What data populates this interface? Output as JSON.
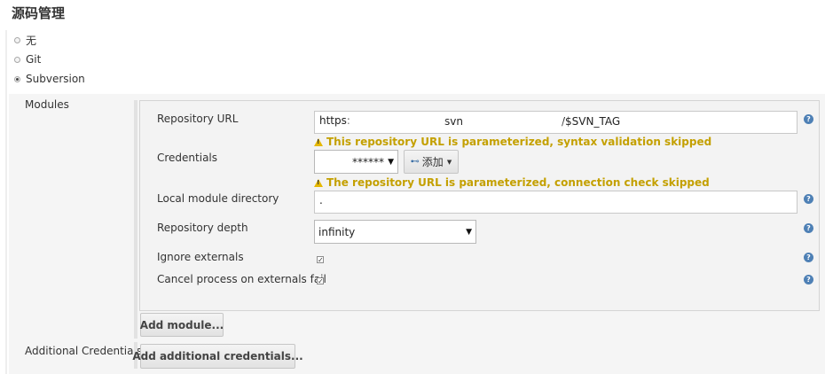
{
  "section": {
    "title": "源码管理"
  },
  "scm_options": [
    {
      "label": "无",
      "selected": false
    },
    {
      "label": "Git",
      "selected": false
    },
    {
      "label": "Subversion",
      "selected": true
    }
  ],
  "modules": {
    "label": "Modules",
    "repository_url": {
      "label": "Repository URL",
      "value_prefix": "https:",
      "value_mid": "svn",
      "value_suffix": "/$SVN_TAG",
      "warning": "This repository URL is parameterized, syntax validation skipped"
    },
    "credentials": {
      "label": "Credentials",
      "value": "******",
      "add_button": "添加",
      "warning": "The repository URL is parameterized, connection check skipped"
    },
    "local_module_directory": {
      "label": "Local module directory",
      "value": "."
    },
    "repository_depth": {
      "label": "Repository depth",
      "value": "infinity"
    },
    "ignore_externals": {
      "label": "Ignore externals",
      "checked": true
    },
    "cancel_process": {
      "label": "Cancel process on externals fail",
      "checked": true
    },
    "add_module_button": "Add module..."
  },
  "additional_credentials": {
    "label": "Additional Credentials",
    "button": "Add additional credentials..."
  },
  "icons": {
    "help": "help-icon",
    "warning": "warning-icon",
    "key": "key-icon",
    "dropdown": "chevron-down-icon"
  },
  "colors": {
    "warning_text": "#c4a000",
    "help_icon": "#4e80b5",
    "panel_bg": "#f3f3f3"
  }
}
